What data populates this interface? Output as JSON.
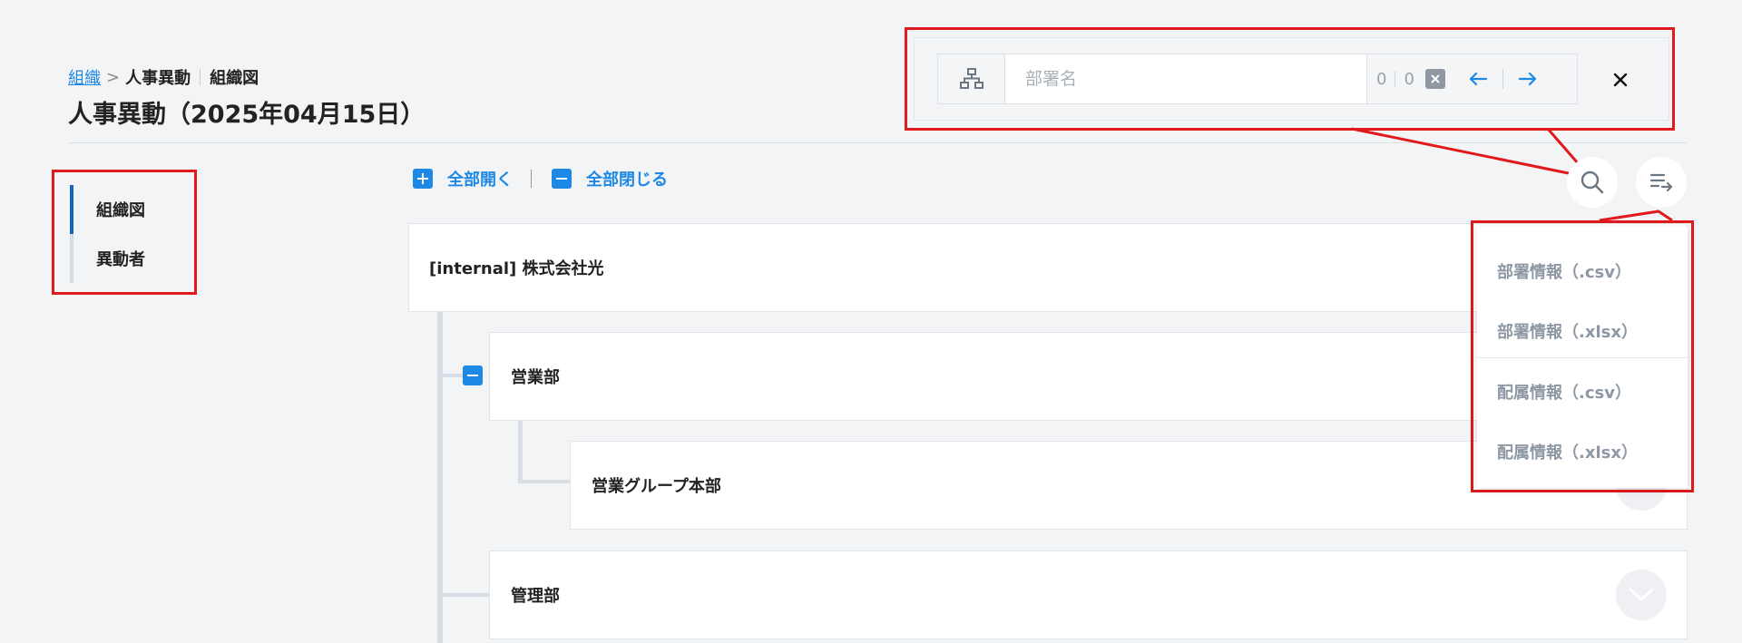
{
  "breadcrumb": {
    "link": "組織",
    "separator": ">",
    "current": "人事異動",
    "sub": "組織図"
  },
  "page_title": "人事異動（2025年04月15日）",
  "side_nav": {
    "items": [
      {
        "label": "組織図",
        "active": true
      },
      {
        "label": "異動者",
        "active": false
      }
    ]
  },
  "toolbar": {
    "expand_all": "全部開く",
    "collapse_all": "全部閉じる"
  },
  "tree": {
    "root": "[internal] 株式会社光",
    "sales": "営業部",
    "sales_group": "営業グループ本部",
    "admin": "管理部"
  },
  "search": {
    "placeholder": "部署名",
    "value": "",
    "current_index": "0",
    "total": "0"
  },
  "export_menu": {
    "items": [
      "部署情報（.csv）",
      "部署情報（.xlsx）",
      "配属情報（.csv）",
      "配属情報（.xlsx）"
    ]
  },
  "colors": {
    "accent": "#1e88e5",
    "highlight": "#e0191d",
    "active_nav": "#1565c0"
  }
}
